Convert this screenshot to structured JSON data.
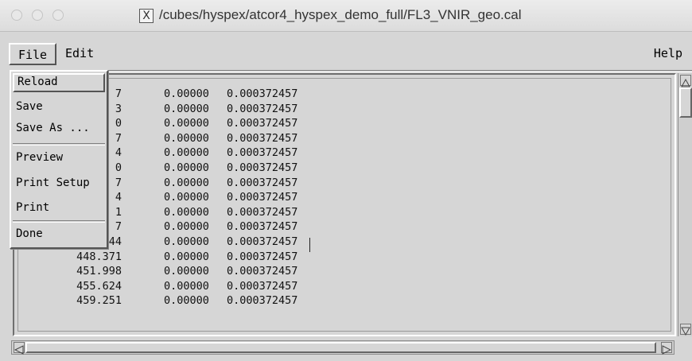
{
  "window": {
    "title": "/cubes/hyspex/atcor4_hyspex_demo_full/FL3_VNIR_geo.cal",
    "x_icon": "X"
  },
  "menubar": {
    "file_label": "File",
    "edit_label": "Edit",
    "help_label": "Help"
  },
  "file_menu": {
    "items": [
      "Reload",
      "Save",
      "Save As ...",
      "Preview",
      "Print Setup",
      "Print",
      "Done"
    ],
    "active_item": "Reload"
  },
  "table": {
    "rows": [
      [
        "7",
        "0.00000",
        "0.000372457"
      ],
      [
        "3",
        "0.00000",
        "0.000372457"
      ],
      [
        "0",
        "0.00000",
        "0.000372457"
      ],
      [
        "7",
        "0.00000",
        "0.000372457"
      ],
      [
        "4",
        "0.00000",
        "0.000372457"
      ],
      [
        "0",
        "0.00000",
        "0.000372457"
      ],
      [
        "7",
        "0.00000",
        "0.000372457"
      ],
      [
        "4",
        "0.00000",
        "0.000372457"
      ],
      [
        "1",
        "0.00000",
        "0.000372457"
      ],
      [
        "7",
        "0.00000",
        "0.000372457"
      ],
      [
        "444.744",
        "0.00000",
        "0.000372457"
      ],
      [
        "448.371",
        "0.00000",
        "0.000372457"
      ],
      [
        "451.998",
        "0.00000",
        "0.000372457"
      ],
      [
        "455.624",
        "0.00000",
        "0.000372457"
      ],
      [
        "459.251",
        "0.00000",
        "0.000372457"
      ]
    ]
  },
  "icons": {
    "scroll_up": "triangle-up",
    "scroll_down": "triangle-down",
    "scroll_left": "triangle-left",
    "scroll_right": "triangle-right"
  }
}
